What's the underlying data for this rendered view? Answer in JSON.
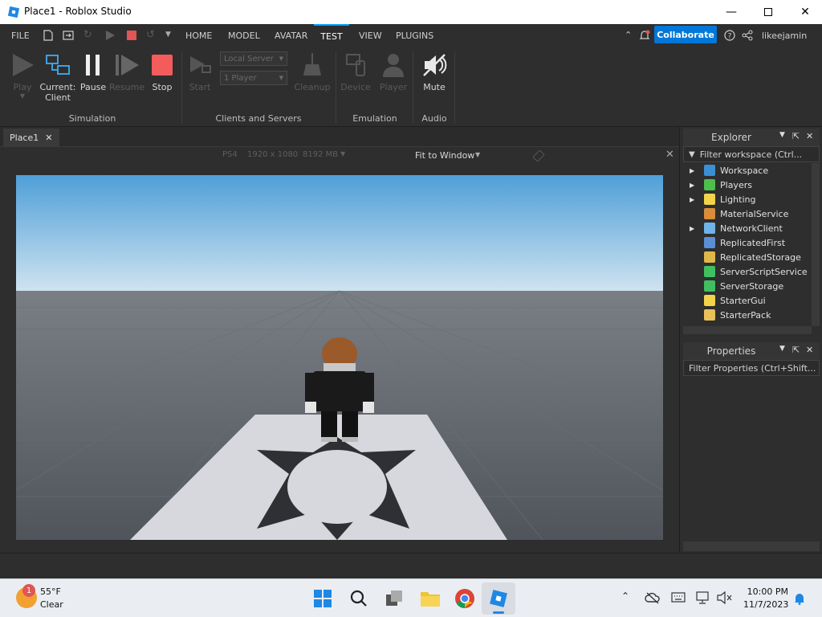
{
  "window": {
    "title": "Place1 - Roblox Studio"
  },
  "menubar": {
    "file": "FILE",
    "tabs": [
      "HOME",
      "MODEL",
      "AVATAR",
      "TEST",
      "VIEW",
      "PLUGINS"
    ],
    "active_tab": "TEST",
    "collaborate": "Collaborate",
    "username": "likeejamin"
  },
  "ribbon": {
    "play": "Play",
    "current_client_1": "Current:",
    "current_client_2": "Client",
    "pause": "Pause",
    "resume": "Resume",
    "stop": "Stop",
    "start": "Start",
    "server_dropdown": "Local Server",
    "players_dropdown": "1 Player",
    "cleanup": "Cleanup",
    "device": "Device",
    "player": "Player",
    "mute": "Mute",
    "groups": {
      "simulation": "Simulation",
      "clients_servers": "Clients and Servers",
      "emulation": "Emulation",
      "audio": "Audio"
    }
  },
  "document": {
    "tab": "Place1",
    "device": "PS4",
    "resolution": "1920 x 1080",
    "memory": "8192 MB",
    "fit": "Fit to Window"
  },
  "explorer": {
    "title": "Explorer",
    "filter": "Filter workspace (Ctrl...",
    "items": [
      {
        "label": "Workspace",
        "expandable": true,
        "color": "#3b8fd4"
      },
      {
        "label": "Players",
        "expandable": true,
        "color": "#4cbf4c"
      },
      {
        "label": "Lighting",
        "expandable": true,
        "color": "#f2d34a"
      },
      {
        "label": "MaterialService",
        "expandable": false,
        "color": "#d98c3a"
      },
      {
        "label": "NetworkClient",
        "expandable": true,
        "color": "#6fb3e8"
      },
      {
        "label": "ReplicatedFirst",
        "expandable": false,
        "color": "#5a8fd4"
      },
      {
        "label": "ReplicatedStorage",
        "expandable": false,
        "color": "#e0b84a"
      },
      {
        "label": "ServerScriptService",
        "expandable": false,
        "color": "#3fbf5f"
      },
      {
        "label": "ServerStorage",
        "expandable": false,
        "color": "#3fbf5f"
      },
      {
        "label": "StarterGui",
        "expandable": false,
        "color": "#f2d34a"
      },
      {
        "label": "StarterPack",
        "expandable": false,
        "color": "#e8c05a"
      }
    ]
  },
  "properties": {
    "title": "Properties",
    "filter": "Filter Properties (Ctrl+Shift..."
  },
  "taskbar": {
    "weather_temp": "55°F",
    "weather_desc": "Clear",
    "weather_badge": "1",
    "time": "10:00 PM",
    "date": "11/7/2023"
  }
}
